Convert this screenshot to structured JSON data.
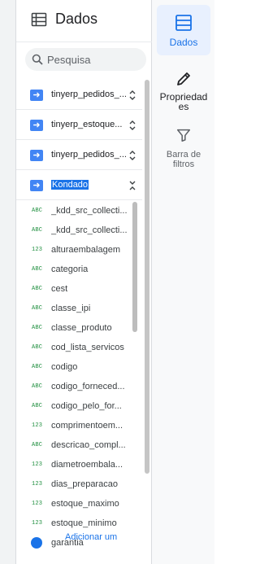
{
  "panel": {
    "title": "Dados",
    "search_placeholder": "Pesquisa"
  },
  "sources": [
    {
      "label": "tinyerp_pedidos_...",
      "icon": "data-source-icon",
      "chevron": "unfold-icon"
    },
    {
      "label": "tinyerp_estoque...",
      "icon": "data-source-icon",
      "chevron": "unfold-icon"
    },
    {
      "label": "tinyerp_pedidos_...",
      "icon": "data-source-icon",
      "chevron": "unfold-icon"
    },
    {
      "label": "Kondado",
      "icon": "data-source-icon",
      "chevron": "fold-icon",
      "selected": true
    }
  ],
  "fields": [
    {
      "type": "ABC",
      "name": "_kdd_src_collecti..."
    },
    {
      "type": "ABC",
      "name": "_kdd_src_collecti..."
    },
    {
      "type": "123",
      "name": "alturaembalagem"
    },
    {
      "type": "ABC",
      "name": "categoria"
    },
    {
      "type": "ABC",
      "name": "cest"
    },
    {
      "type": "ABC",
      "name": "classe_ipi"
    },
    {
      "type": "ABC",
      "name": "classe_produto"
    },
    {
      "type": "ABC",
      "name": "cod_lista_servicos"
    },
    {
      "type": "ABC",
      "name": "codigo"
    },
    {
      "type": "ABC",
      "name": "codigo_forneced..."
    },
    {
      "type": "ABC",
      "name": "codigo_pelo_for..."
    },
    {
      "type": "123",
      "name": "comprimentoem..."
    },
    {
      "type": "ABC",
      "name": "descricao_compl..."
    },
    {
      "type": "123",
      "name": "diametroembala..."
    },
    {
      "type": "123",
      "name": "dias_preparacao"
    },
    {
      "type": "123",
      "name": "estoque_maximo"
    },
    {
      "type": "123",
      "name": "estoque_minimo"
    },
    {
      "type": "ABC",
      "name": "garantia"
    }
  ],
  "add_field_label": "Adicionar um",
  "rail": {
    "items": [
      {
        "label": "Dados",
        "icon": "table-icon",
        "active": true
      },
      {
        "label": "Propriedades",
        "label_line1": "Propriedad",
        "label_line2": "es",
        "icon": "pencil-icon"
      },
      {
        "label": "Barra de filtros",
        "label_line1": "Barra de",
        "label_line2": "filtros",
        "icon": "filter-icon"
      }
    ]
  },
  "colors": {
    "accent": "#1a73e8",
    "source_badge": "#4285f4",
    "field_type": "#1e8e3e",
    "rail_active_bg": "#e8f0fe"
  }
}
